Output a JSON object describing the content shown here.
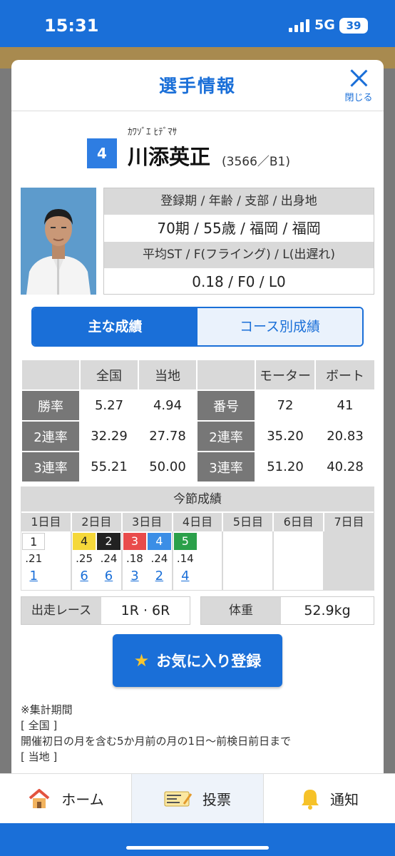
{
  "status": {
    "time": "15:31",
    "network": "5G",
    "battery": "39"
  },
  "modal": {
    "title": "選手情報",
    "close_label": "閉じる"
  },
  "player": {
    "kana": "ｶﾜｿﾞｴ ﾋﾃﾞﾏｻ",
    "lane": "4",
    "name": "川添英正",
    "reg": "(3566／B1)"
  },
  "profile": {
    "h1": "登録期 / 年齢 / 支部 / 出身地",
    "v1": "70期 / 55歳 / 福岡 / 福岡",
    "h2": "平均ST / F(フライング) / L(出遅れ)",
    "v2": "0.18 / F0 / L0"
  },
  "tabs": {
    "main": "主な成績",
    "course": "コース別成績"
  },
  "stats": {
    "head_national": "全国",
    "head_local": "当地",
    "head_motor": "モーター",
    "head_boat": "ボート",
    "rows": [
      {
        "label": "勝率",
        "national": "5.27",
        "local": "4.94",
        "mlabel": "番号",
        "motor": "72",
        "boat": "41"
      },
      {
        "label": "2連率",
        "national": "32.29",
        "local": "27.78",
        "mlabel": "2連率",
        "motor": "35.20",
        "boat": "20.83"
      },
      {
        "label": "3連率",
        "national": "55.21",
        "local": "50.00",
        "mlabel": "3連率",
        "motor": "51.20",
        "boat": "40.28"
      }
    ]
  },
  "season": {
    "title": "今節成績",
    "days": [
      "1日目",
      "2日目",
      "3日目",
      "4日目",
      "5日目",
      "6日目",
      "7日目"
    ],
    "races": [
      {
        "frame": "1",
        "st": ".21",
        "rank": "1"
      },
      {
        "frame": "4",
        "st": ".25",
        "rank": "6"
      },
      {
        "frame": "2",
        "st": ".24",
        "rank": "6"
      },
      {
        "frame": "3",
        "st": ".18",
        "rank": "3"
      },
      {
        "frame": "4",
        "st": ".24",
        "rank": "2"
      },
      {
        "frame": "5",
        "st": ".14",
        "rank": "4"
      }
    ]
  },
  "entries": {
    "label": "出走レース",
    "value": "1R · 6R"
  },
  "weight": {
    "label": "体重",
    "value": "52.9kg"
  },
  "favorite_label": "お気に入り登録",
  "note": {
    "line1": "※集計期間",
    "line2": "[ 全国 ]",
    "line3": "開催初日の月を含む5か月前の月の1日〜前検日前日まで",
    "line4": "[ 当地 ]"
  },
  "nav": {
    "home": "ホーム",
    "vote": "投票",
    "notify": "通知"
  },
  "colors": {
    "accent": "#1a6fd8",
    "header_grey": "#d9d9d9",
    "row_label_grey": "#777777"
  }
}
